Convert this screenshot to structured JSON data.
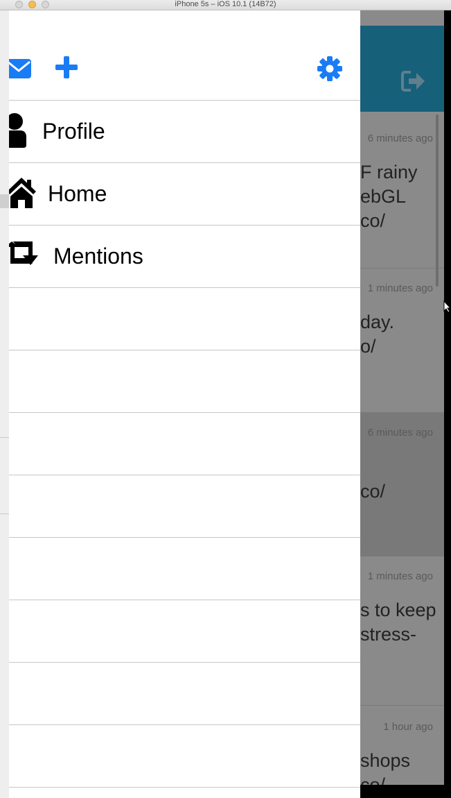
{
  "window": {
    "title": "iPhone 5s – iOS 10.1 (14B72)"
  },
  "colors": {
    "accent": "#1a7cf5",
    "header_bg": "#17607a",
    "drawer_bg": "#ffffff",
    "overlay_bg": "#8a8a8a"
  },
  "drawer": {
    "top_icons": [
      "envelope-icon",
      "plus-icon",
      "gear-icon"
    ],
    "menu": [
      {
        "label": "Profile",
        "icon": "user-icon"
      },
      {
        "label": "Home",
        "icon": "home-icon"
      },
      {
        "label": "Mentions",
        "icon": "retweet-icon"
      }
    ]
  },
  "feed": {
    "header_icon": "logout-icon",
    "items": [
      {
        "time": "6 minutes ago",
        "text": "F rainy\nebGL\nco/"
      },
      {
        "time": "1 minutes ago",
        "text": "day.\no/"
      },
      {
        "time": "6 minutes ago",
        "text": "co/"
      },
      {
        "time": "1 minutes ago",
        "text": "s to keep\nstress-"
      },
      {
        "time": "1 hour ago",
        "text": "shops\nco/"
      }
    ]
  }
}
